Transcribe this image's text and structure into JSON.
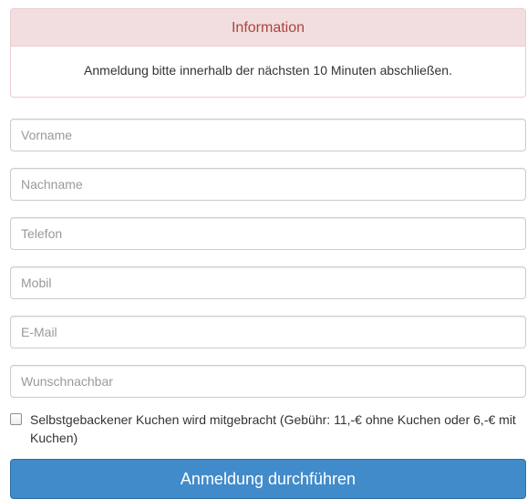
{
  "info": {
    "heading": "Information",
    "message": "Anmeldung bitte innerhalb der nächsten 10 Minuten abschließen."
  },
  "form": {
    "fields": [
      {
        "placeholder": "Vorname",
        "value": ""
      },
      {
        "placeholder": "Nachname",
        "value": ""
      },
      {
        "placeholder": "Telefon",
        "value": ""
      },
      {
        "placeholder": "Mobil",
        "value": ""
      },
      {
        "placeholder": "E-Mail",
        "value": ""
      },
      {
        "placeholder": "Wunschnachbar",
        "value": ""
      }
    ],
    "cake_checkbox": {
      "label": "Selbstgebackener Kuchen wird mitgebracht (Gebühr: 11,-€ ohne Kuchen oder 6,-€ mit Kuchen)",
      "checked": false
    },
    "submit_label": "Anmeldung durchführen"
  },
  "colors": {
    "info_heading_bg": "#f2dede",
    "info_heading_text": "#a94442",
    "info_border": "#ebccd1",
    "primary_button": "#428bca"
  }
}
